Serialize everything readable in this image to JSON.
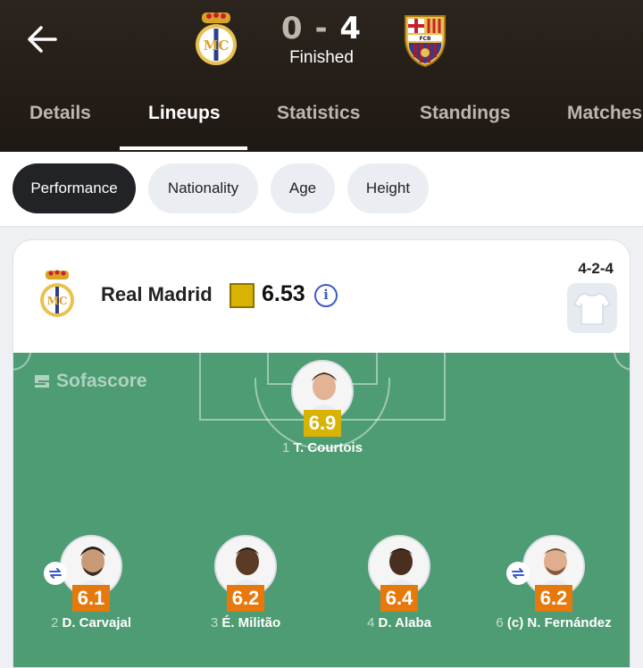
{
  "header": {
    "score": {
      "home": "0",
      "separator": "-",
      "away": "4"
    },
    "status": "Finished",
    "home_team": "Real Madrid",
    "away_team": "Barcelona"
  },
  "tabs": [
    {
      "label": "Details",
      "active": false
    },
    {
      "label": "Lineups",
      "active": true
    },
    {
      "label": "Statistics",
      "active": false
    },
    {
      "label": "Standings",
      "active": false
    },
    {
      "label": "Matches",
      "active": false
    }
  ],
  "filters": [
    {
      "label": "Performance",
      "active": true
    },
    {
      "label": "Nationality",
      "active": false
    },
    {
      "label": "Age",
      "active": false
    },
    {
      "label": "Height",
      "active": false
    }
  ],
  "team_card": {
    "team_name": "Real Madrid",
    "avg_rating": "6.53",
    "formation": "4-2-4",
    "info_icon": "info-icon"
  },
  "pitch": {
    "watermark": "Sofascore",
    "players": [
      {
        "number": "1",
        "name": "T. Courtois",
        "rating": "6.9",
        "rating_color": "#d9b304",
        "substituted": false
      },
      {
        "number": "2",
        "name": "D. Carvajal",
        "rating": "6.1",
        "rating_color": "#e6780c",
        "substituted": true
      },
      {
        "number": "3",
        "name": "É. Militão",
        "rating": "6.2",
        "rating_color": "#e6780c",
        "substituted": false
      },
      {
        "number": "4",
        "name": "D. Alaba",
        "rating": "6.4",
        "rating_color": "#e6780c",
        "substituted": false
      },
      {
        "number": "6",
        "name": "(c) N. Fernández",
        "rating": "6.2",
        "rating_color": "#e6780c",
        "substituted": true
      }
    ]
  },
  "colors": {
    "header_bg": "#241d17",
    "pitch_green": "#4e9c73",
    "rating_yellow": "#d9b304",
    "rating_orange": "#e6780c",
    "accent_blue": "#3a5bcc"
  }
}
